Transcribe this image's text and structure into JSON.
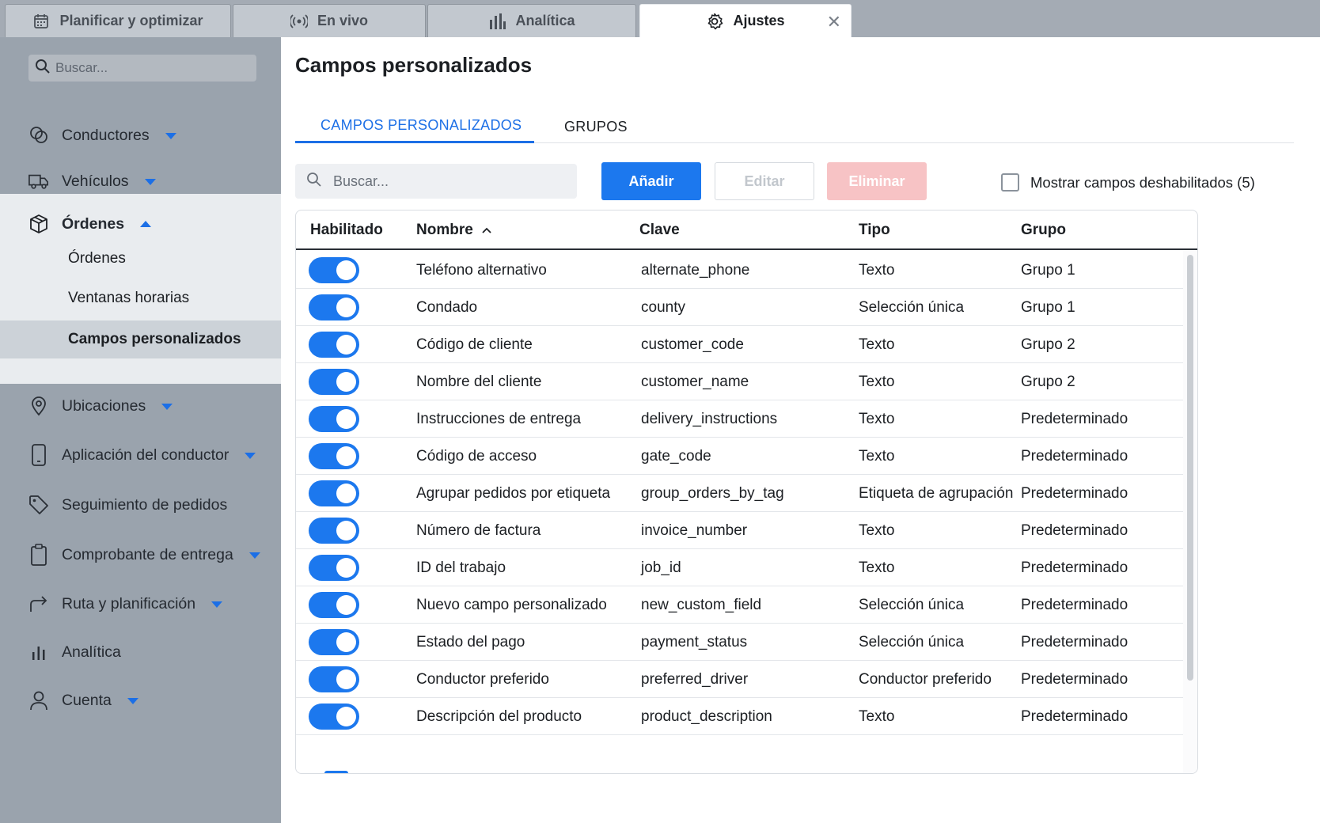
{
  "tabs": [
    {
      "label": "Planificar y optimizar",
      "icon": "calendar-icon"
    },
    {
      "label": "En vivo",
      "icon": "broadcast-icon"
    },
    {
      "label": "Analítica",
      "icon": "bar-chart-icon"
    },
    {
      "label": "Ajustes",
      "icon": "gear-icon",
      "active": true
    }
  ],
  "sidebar": {
    "search_placeholder": "Buscar...",
    "items": [
      {
        "label": "Conductores",
        "icon": "drivers-icon",
        "expandable": true
      },
      {
        "label": "Vehículos",
        "icon": "truck-icon",
        "expandable": true
      },
      {
        "label": "Órdenes",
        "icon": "box-icon",
        "expanded": true
      },
      {
        "label": "Ubicaciones",
        "icon": "pin-icon",
        "expandable": true
      },
      {
        "label": "Aplicación del conductor",
        "icon": "phone-icon",
        "expandable": true
      },
      {
        "label": "Seguimiento de pedidos",
        "icon": "tag-icon"
      },
      {
        "label": "Comprobante de entrega",
        "icon": "clipboard-icon",
        "expandable": true
      },
      {
        "label": "Ruta y planificación",
        "icon": "route-arrow-icon",
        "expandable": true
      },
      {
        "label": "Analítica",
        "icon": "bar-chart-icon"
      },
      {
        "label": "Cuenta",
        "icon": "user-icon",
        "expandable": true
      }
    ],
    "subitems": [
      "Órdenes",
      "Ventanas horarias",
      "Campos personalizados"
    ]
  },
  "main": {
    "title": "Campos personalizados",
    "subtabs": [
      "CAMPOS PERSONALIZADOS",
      "GRUPOS"
    ],
    "search_placeholder": "Buscar...",
    "buttons": {
      "add": "Añadir",
      "edit": "Editar",
      "delete": "Eliminar"
    },
    "show_disabled_label": "Mostrar campos deshabilitados (5)"
  },
  "table": {
    "headers": [
      "Habilitado",
      "Nombre",
      "Clave",
      "Tipo",
      "Grupo"
    ],
    "rows": [
      {
        "enabled": true,
        "name": "Teléfono alternativo",
        "key": "alternate_phone",
        "type": "Texto",
        "group": "Grupo 1"
      },
      {
        "enabled": true,
        "name": "Condado",
        "key": "county",
        "type": "Selección única",
        "group": "Grupo 1"
      },
      {
        "enabled": true,
        "name": "Código de cliente",
        "key": "customer_code",
        "type": "Texto",
        "group": "Grupo 2"
      },
      {
        "enabled": true,
        "name": "Nombre del cliente",
        "key": "customer_name",
        "type": "Texto",
        "group": "Grupo 2"
      },
      {
        "enabled": true,
        "name": "Instrucciones de entrega",
        "key": "delivery_instructions",
        "type": "Texto",
        "group": "Predeterminado"
      },
      {
        "enabled": true,
        "name": "Código de acceso",
        "key": "gate_code",
        "type": "Texto",
        "group": "Predeterminado"
      },
      {
        "enabled": true,
        "name": "Agrupar pedidos por etiqueta",
        "key": "group_orders_by_tag",
        "type": "Etiqueta de agrupación",
        "group": "Predeterminado"
      },
      {
        "enabled": true,
        "name": "Número de factura",
        "key": "invoice_number",
        "type": "Texto",
        "group": "Predeterminado"
      },
      {
        "enabled": true,
        "name": "ID del trabajo",
        "key": "job_id",
        "type": "Texto",
        "group": "Predeterminado"
      },
      {
        "enabled": true,
        "name": "Nuevo campo personalizado",
        "key": "new_custom_field",
        "type": "Selección única",
        "group": "Predeterminado"
      },
      {
        "enabled": true,
        "name": "Estado del pago",
        "key": "payment_status",
        "type": "Selección única",
        "group": "Predeterminado"
      },
      {
        "enabled": true,
        "name": "Conductor preferido",
        "key": "preferred_driver",
        "type": "Conductor preferido",
        "group": "Predeterminado"
      },
      {
        "enabled": true,
        "name": "Descripción del producto",
        "key": "product_description",
        "type": "Texto",
        "group": "Predeterminado"
      }
    ]
  },
  "colors": {
    "accent": "#1c78ee",
    "delete_disabled": "#f7c3c5",
    "sidebar_bg": "#9aa3ad"
  }
}
